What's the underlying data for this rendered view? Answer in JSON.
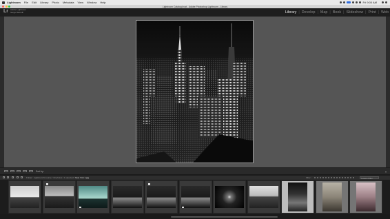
{
  "menubar": {
    "app": "Lightroom",
    "items": [
      "File",
      "Edit",
      "Library",
      "Photo",
      "Metadata",
      "View",
      "Window",
      "Help"
    ],
    "clock": "Fri 9:00 AM"
  },
  "window": {
    "title": "Lightroom Catalog.lrcat - Adobe Photoshop Lightroom - Library"
  },
  "identity": {
    "logo": "Lr",
    "line1": "Adobe Lightroom",
    "line2": "Serge Ramelli"
  },
  "modules": {
    "items": [
      "Library",
      "Develop",
      "Map",
      "Book",
      "Slideshow",
      "Print",
      "Web"
    ],
    "active": "Library",
    "separator": "|"
  },
  "toolbar": {
    "sort_label": "Sort by:"
  },
  "filmstrip_bar": {
    "source_prefix": "Folder : Lightroom 5 course / 10 photos / 1 selected /",
    "selected_file": "New York 1.jpg",
    "filter_label": "Filter :",
    "custom_label": "Custom Filter"
  },
  "thumbnails": [
    {
      "number": "1",
      "kind": "landscape",
      "style": "city-bw"
    },
    {
      "number": "2",
      "kind": "landscape",
      "style": "bridge"
    },
    {
      "number": "3",
      "kind": "landscape",
      "style": "teal"
    },
    {
      "number": "4",
      "kind": "landscape",
      "style": "night"
    },
    {
      "number": "5",
      "kind": "landscape",
      "style": "night"
    },
    {
      "number": "6",
      "kind": "landscape",
      "style": "night"
    },
    {
      "number": "7",
      "kind": "landscape",
      "style": "tunnel"
    },
    {
      "number": "8",
      "kind": "landscape",
      "style": "skyline"
    },
    {
      "number": "9",
      "kind": "portrait",
      "style": "tower",
      "selected": true
    },
    {
      "number": "10",
      "kind": "portrait",
      "style": "sepia"
    },
    {
      "number": "11",
      "kind": "portrait",
      "style": "pink"
    }
  ],
  "colors": {
    "panel_bg": "#2b2b2b",
    "loupe_bg": "#555555",
    "active_module": "#e6e6e6",
    "selected_cell": "#bdbdbd"
  }
}
